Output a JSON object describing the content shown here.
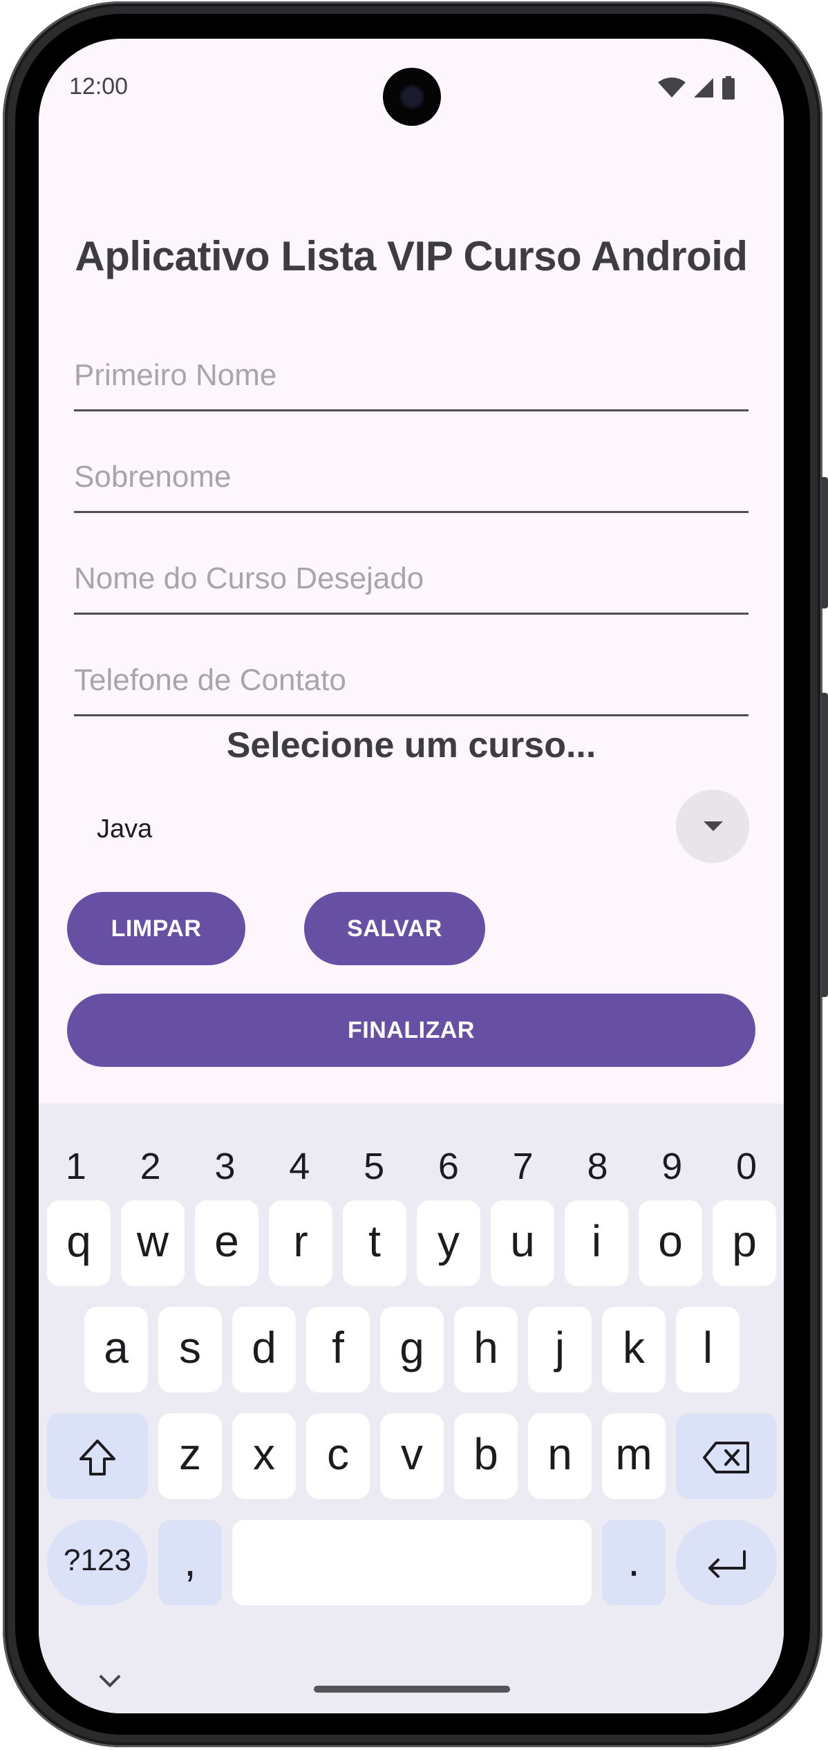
{
  "status_bar": {
    "time": "12:00",
    "icons": [
      "wifi-icon",
      "signal-icon",
      "battery-icon"
    ]
  },
  "app": {
    "title": "Aplicativo Lista VIP Curso Android",
    "fields": {
      "first_name_placeholder": "Primeiro Nome",
      "last_name_placeholder": "Sobrenome",
      "course_name_placeholder": "Nome do Curso Desejado",
      "phone_placeholder": "Telefone de Contato"
    },
    "select_label": "Selecione um curso...",
    "spinner_value": "Java",
    "buttons": {
      "clear": "LIMPAR",
      "save": "SALVAR",
      "finish": "FINALIZAR"
    }
  },
  "keyboard": {
    "number_row": [
      "1",
      "2",
      "3",
      "4",
      "5",
      "6",
      "7",
      "8",
      "9",
      "0"
    ],
    "row1": [
      "q",
      "w",
      "e",
      "r",
      "t",
      "y",
      "u",
      "i",
      "o",
      "p"
    ],
    "row2": [
      "a",
      "s",
      "d",
      "f",
      "g",
      "h",
      "j",
      "k",
      "l"
    ],
    "row3": [
      "z",
      "x",
      "c",
      "v",
      "b",
      "n",
      "m"
    ],
    "symbols_key": "?123",
    "comma_key": ",",
    "period_key": "."
  },
  "colors": {
    "primary": "#6750a4",
    "background": "#fdf7fd",
    "keyboard_bg": "#ecebf3",
    "fn_key": "#dbe1f7"
  }
}
